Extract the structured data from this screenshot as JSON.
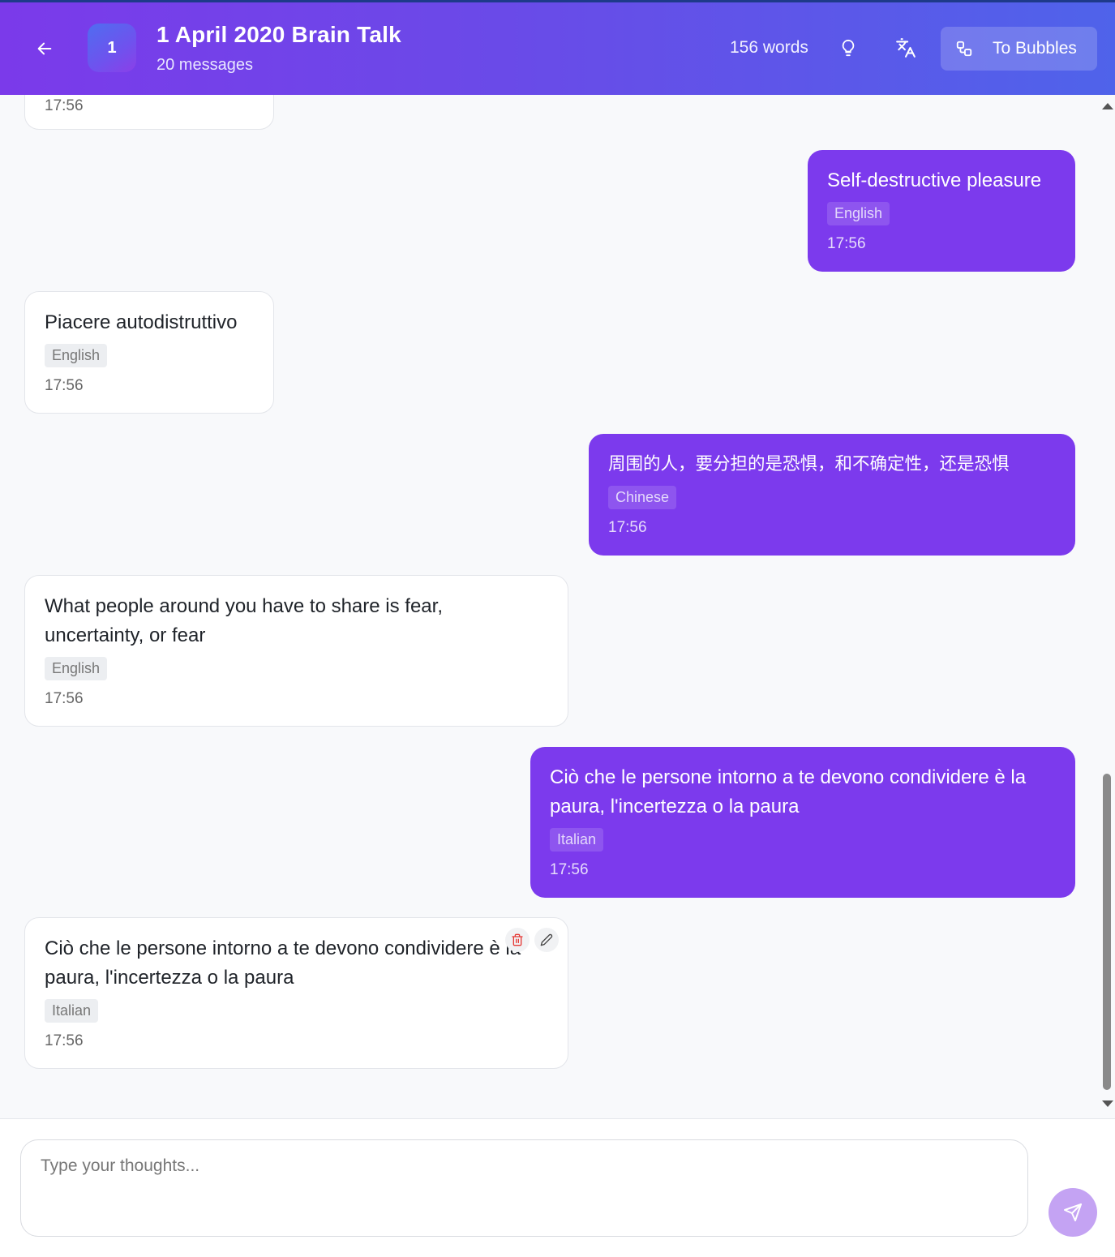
{
  "header": {
    "avatar_text": "1",
    "title": "1 April 2020 Brain Talk",
    "subtitle": "20 messages",
    "word_count": "156 words",
    "bubbles_label": "To Bubbles"
  },
  "messages": [
    {
      "side": "left",
      "text": "",
      "language": "",
      "time": "17:56"
    },
    {
      "side": "right",
      "text": "Self-destructive pleasure",
      "language": "English",
      "time": "17:56"
    },
    {
      "side": "left",
      "text": "Piacere autodistruttivo",
      "language": "English",
      "time": "17:56"
    },
    {
      "side": "right",
      "text": "周围的人，要分担的是恐惧，和不确定性，还是恐惧",
      "language": "Chinese",
      "time": "17:56"
    },
    {
      "side": "left",
      "text": "What people around you have to share is fear, uncertainty, or fear",
      "language": "English",
      "time": "17:56"
    },
    {
      "side": "right",
      "text": "Ciò che le persone intorno a te devono condividere è la paura, l'incertezza o la paura",
      "language": "Italian",
      "time": "17:56"
    },
    {
      "side": "left",
      "text": "Ciò che le persone intorno a te devono condividere è la paura, l'incertezza o la paura",
      "language": "Italian",
      "time": "17:56"
    }
  ],
  "composer": {
    "placeholder": "Type your thoughts..."
  },
  "colors": {
    "accent": "#7c3aed",
    "header_start": "#7b3aea",
    "header_end": "#4f63ea",
    "send_button": "#c4a3f3",
    "delete_icon": "#e53935"
  },
  "icons": [
    "back-arrow-icon",
    "lightbulb-icon",
    "translate-icon",
    "bubbles-icon",
    "trash-icon",
    "pencil-icon",
    "send-icon"
  ]
}
